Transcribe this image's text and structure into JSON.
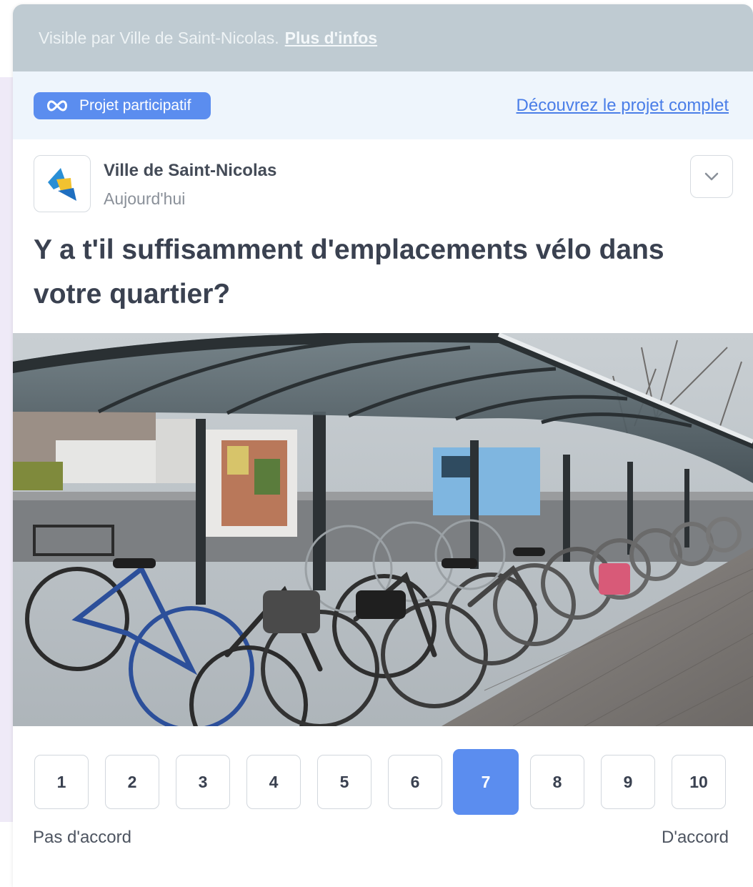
{
  "visibility": {
    "text": "Visible par Ville de Saint-Nicolas.",
    "link": "Plus d'infos"
  },
  "project": {
    "badge_label": "Projet participatif",
    "badge_icon": "infinity-icon",
    "link": "Découvrez le projet complet"
  },
  "post": {
    "author": "Ville de Saint-Nicolas",
    "date": "Aujourd'hui",
    "menu_icon": "chevron-down-icon",
    "question": "Y a t'il suffisamment d'emplacements vélo dans votre quartier?"
  },
  "photo": {
    "subject": "bicycle-parking-shelter"
  },
  "rating": {
    "options": [
      "1",
      "2",
      "3",
      "4",
      "5",
      "6",
      "7",
      "8",
      "9",
      "10"
    ],
    "selected": "7",
    "min_label": "Pas d'accord",
    "max_label": "D'accord"
  },
  "colors": {
    "accent": "#5b8def",
    "visibility_bar": "#bfcbd2",
    "project_bar": "#eef5fc",
    "title_text": "#3a4150"
  }
}
